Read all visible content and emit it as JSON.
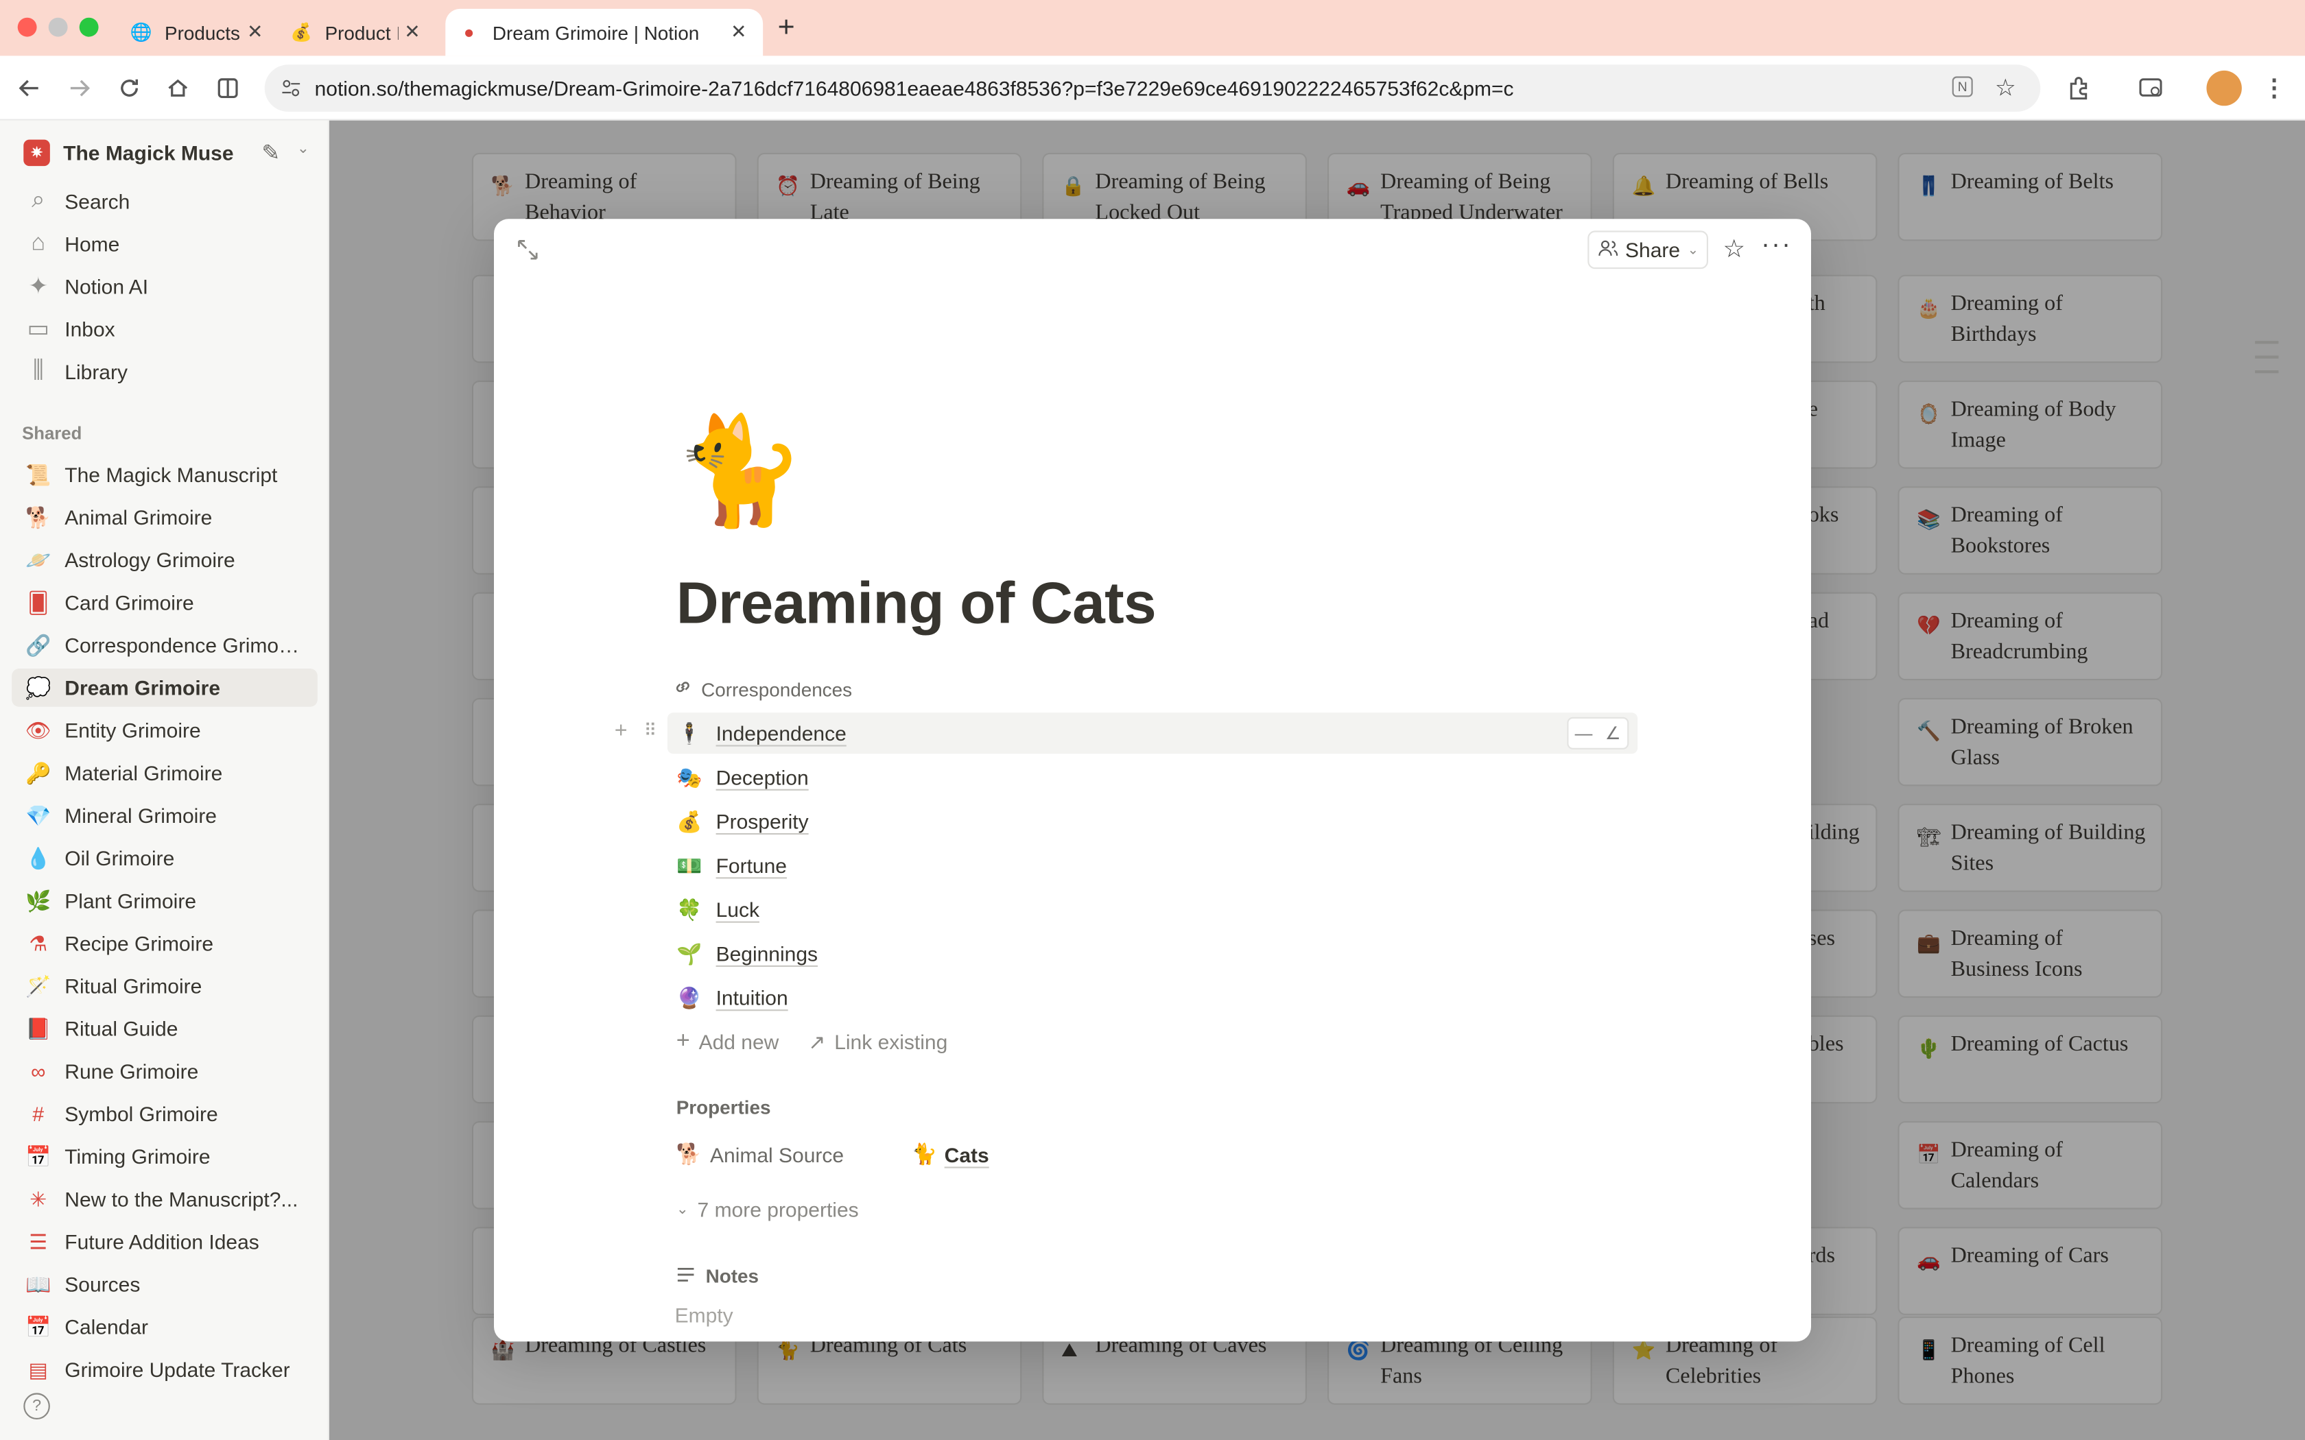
{
  "browser": {
    "tabs": [
      {
        "title": "Products",
        "icon": "globe-icon"
      },
      {
        "title": "Product I",
        "icon": "money-bag-icon"
      },
      {
        "title": "Dream Grimoire | Notion",
        "icon": "notion-page-icon"
      }
    ],
    "url": "notion.so/themagickmuse/Dream-Grimoire-2a716dcf7164806981eaeae4863f8536?p=f3e7229e69ce4691902222465753f62c&pm=c"
  },
  "sidebar": {
    "workspace": "The Magick Muse",
    "nav": [
      {
        "label": "Search",
        "icon": "search-icon"
      },
      {
        "label": "Home",
        "icon": "home-icon"
      },
      {
        "label": "Notion AI",
        "icon": "ai-icon"
      },
      {
        "label": "Inbox",
        "icon": "inbox-icon"
      },
      {
        "label": "Library",
        "icon": "library-icon"
      }
    ],
    "shared_heading": "Shared",
    "pages": [
      {
        "label": "The Magick Manuscript",
        "icon": "📜",
        "color": "#a0522d"
      },
      {
        "label": "Animal Grimoire",
        "icon": "🐕",
        "color": "#d9463d"
      },
      {
        "label": "Astrology Grimoire",
        "icon": "🪐",
        "color": "#d9463d"
      },
      {
        "label": "Card Grimoire",
        "icon": "🂠",
        "color": "#d9463d"
      },
      {
        "label": "Correspondence Grimoi...",
        "icon": "🔗",
        "color": "#d9463d"
      },
      {
        "label": "Dream Grimoire",
        "icon": "💭",
        "color": "#d9463d"
      },
      {
        "label": "Entity Grimoire",
        "icon": "👁",
        "color": "#d9463d"
      },
      {
        "label": "Material Grimoire",
        "icon": "🔑",
        "color": "#d9463d"
      },
      {
        "label": "Mineral Grimoire",
        "icon": "💎",
        "color": "#d9463d"
      },
      {
        "label": "Oil Grimoire",
        "icon": "💧",
        "color": "#d9463d"
      },
      {
        "label": "Plant Grimoire",
        "icon": "🌿",
        "color": "#d9463d"
      },
      {
        "label": "Recipe Grimoire",
        "icon": "⚗",
        "color": "#d9463d"
      },
      {
        "label": "Ritual Grimoire",
        "icon": "🪄",
        "color": "#d9463d"
      },
      {
        "label": "Ritual Guide",
        "icon": "📕",
        "color": "#d9463d"
      },
      {
        "label": "Rune Grimoire",
        "icon": "∞",
        "color": "#d9463d"
      },
      {
        "label": "Symbol Grimoire",
        "icon": "#",
        "color": "#d9463d"
      },
      {
        "label": "Timing Grimoire",
        "icon": "📅",
        "color": "#d9463d"
      },
      {
        "label": "New to the Manuscript?...",
        "icon": "✳",
        "color": "#d9463d"
      },
      {
        "label": "Future Addition Ideas",
        "icon": "☰",
        "color": "#d9463d"
      },
      {
        "label": "Sources",
        "icon": "📖",
        "color": "#d9463d"
      },
      {
        "label": "Calendar",
        "icon": "📅",
        "color": "#d9463d"
      },
      {
        "label": "Grimoire Update Tracker",
        "icon": "▤",
        "color": "#d9463d"
      }
    ]
  },
  "gallery": {
    "cards": [
      {
        "title": "Dreaming of Behavior",
        "icon": "🐕"
      },
      {
        "title": "Dreaming of Being Late",
        "icon": "⏰"
      },
      {
        "title": "Dreaming of Being Locked Out",
        "icon": "🔒"
      },
      {
        "title": "Dreaming of Being Trapped Underwater",
        "icon": "🚗"
      },
      {
        "title": "Dreaming of Bells",
        "icon": "🔔"
      },
      {
        "title": "Dreaming of Belts",
        "icon": "👖"
      },
      {
        "title": "Dreaming of Birthdays",
        "icon": "🎂"
      },
      {
        "title": "Dreaming of Body Image",
        "icon": "🪞"
      },
      {
        "title": "Dreaming of Bookstores",
        "icon": "📚"
      },
      {
        "title": "Dreaming of Breadcrumbing",
        "icon": "💔"
      },
      {
        "title": "Dreaming of Broken Glass",
        "icon": "🔨"
      },
      {
        "title": "Dreaming of Building Sites",
        "icon": "🏗"
      },
      {
        "title": "Dreaming of Business Icons",
        "icon": "💼"
      },
      {
        "title": "Dreaming of Cactus",
        "icon": "🌵"
      },
      {
        "title": "Dreaming of Calendars",
        "icon": "📅"
      },
      {
        "title": "Dreaming of Cars",
        "icon": "🚗"
      },
      {
        "title": "Dreaming of Castles",
        "icon": "🏰"
      },
      {
        "title": "Dreaming of Cats",
        "icon": "🐈"
      },
      {
        "title": "Dreaming of Caves",
        "icon": "⛰"
      },
      {
        "title": "Dreaming of Ceiling Fans",
        "icon": "🌀"
      },
      {
        "title": "Dreaming of Celebrities",
        "icon": "⭐"
      },
      {
        "title": "Dreaming of Cell Phones",
        "icon": "📱"
      }
    ],
    "partial_labels": [
      "th",
      "e",
      "oks",
      "ad",
      "ilding",
      "ses",
      "bles",
      "rds"
    ]
  },
  "modal": {
    "share_label": "Share",
    "page_icon": "🐈",
    "title": "Dreaming of Cats",
    "relation_label": "Correspondences",
    "relations": [
      {
        "label": "Independence",
        "icon": "🕴"
      },
      {
        "label": "Deception",
        "icon": "🎭"
      },
      {
        "label": "Prosperity",
        "icon": "💰"
      },
      {
        "label": "Fortune",
        "icon": "💵"
      },
      {
        "label": "Luck",
        "icon": "🍀"
      },
      {
        "label": "Beginnings",
        "icon": "🌱"
      },
      {
        "label": "Intuition",
        "icon": "🔮"
      }
    ],
    "add_new": "Add new",
    "link_existing": "Link existing",
    "properties_heading": "Properties",
    "animal_source_label": "Animal Source",
    "animal_source_icon": "🐕",
    "animal_source_value_icon": "🐈",
    "animal_source_value": "Cats",
    "more_properties": "7 more properties",
    "notes_label": "Notes",
    "notes_empty": "Empty"
  }
}
